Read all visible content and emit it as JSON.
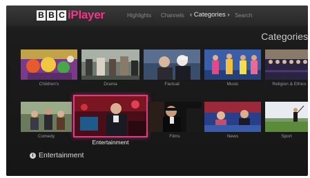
{
  "brand": {
    "bbc_letters": [
      "B",
      "B",
      "C"
    ],
    "product": "iPlayer",
    "accent": "#f0368a"
  },
  "nav": {
    "highlights": "Highlights",
    "channels": "Channels",
    "categories": "‹ Categories ›",
    "search": "Search"
  },
  "page_heading": "Categories",
  "categories_row1": [
    {
      "label": "Children's"
    },
    {
      "label": "Drama"
    },
    {
      "label": "Factual"
    },
    {
      "label": "Music"
    },
    {
      "label": "Religion & Ethics"
    }
  ],
  "categories_row2": [
    {
      "label": "Comedy"
    },
    {
      "label": "Entertainment"
    },
    {
      "label": "Films"
    },
    {
      "label": "News"
    },
    {
      "label": "Sport"
    }
  ],
  "selected_category": "Entertainment",
  "info_text": "Entertainment",
  "selection_color": "#e23b83"
}
